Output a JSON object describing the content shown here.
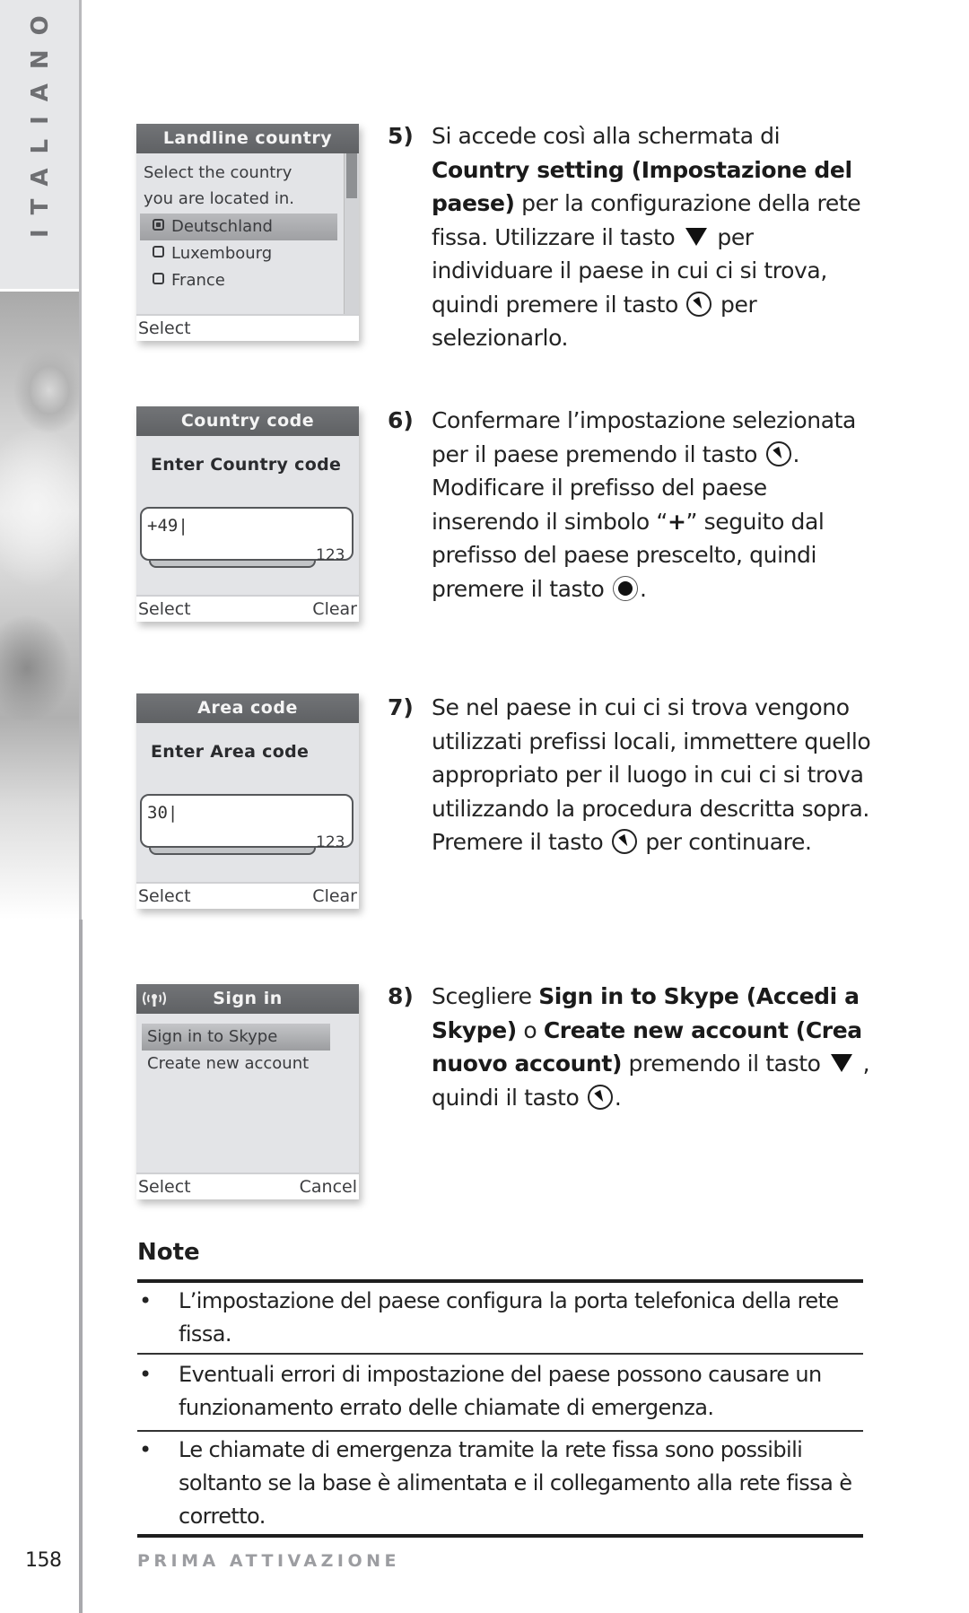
{
  "sidebar": {
    "language_label": "ITALIANO"
  },
  "screens": {
    "landline_country": {
      "title": "Landline country",
      "prompt_line1": "Select the country",
      "prompt_line2": "you are located in.",
      "options": [
        {
          "label": "Deutschland",
          "selected": true
        },
        {
          "label": "Luxembourg",
          "selected": false
        },
        {
          "label": "France",
          "selected": false
        }
      ],
      "softkey_left": "Select"
    },
    "country_code": {
      "title": "Country code",
      "label": "Enter Country code",
      "value": "+49|",
      "input_mode": "123",
      "softkey_left": "Select",
      "softkey_right": "Clear"
    },
    "area_code": {
      "title": "Area code",
      "label": "Enter Area code",
      "value": "30|",
      "input_mode": "123",
      "softkey_left": "Select",
      "softkey_right": "Clear"
    },
    "sign_in": {
      "title": "Sign in",
      "status_icon": "signal-icon",
      "items": [
        {
          "label": "Sign in to Skype",
          "selected": true
        },
        {
          "label": "Create new account",
          "selected": false
        }
      ],
      "softkey_left": "Select",
      "softkey_right": "Cancel"
    }
  },
  "steps": [
    {
      "number": "5)",
      "t1": "Si accede così alla schermata di ",
      "b1": "Country setting (Impostazione del paese)",
      "t2": " per la configurazione della rete fissa. Utilizzare il tasto ",
      "key1": "down-arrow-key",
      "t3": " per individuare il paese in cui ci si trova, quindi premere il tasto ",
      "key2": "ok-key",
      "t4": " per selezionarlo."
    },
    {
      "number": "6)",
      "t1": "Confermare l’impostazione selezionata per il paese premendo il tasto ",
      "key1": "ok-key",
      "t2": ". Modificare il prefisso del paese inserendo il simbolo “",
      "b1": "+",
      "t3": "” seguito dal prefisso del paese prescelto, quindi premere il tasto ",
      "key2": "navigation-key",
      "t4": "."
    },
    {
      "number": "7)",
      "t1": "Se nel paese in cui ci si trova vengono utilizzati prefissi locali, immettere quello appropriato per il luogo in cui ci si trova utilizzando la procedura descritta sopra. Premere il tasto ",
      "key1": "ok-key",
      "t2": " per continuare."
    },
    {
      "number": "8)",
      "t1": "Scegliere ",
      "b1": "Sign in to Skype (Accedi a Skype)",
      "t2": " o ",
      "b2": "Create new account (Crea nuovo account)",
      "t3": " premendo il tasto ",
      "key1": "down-arrow-key",
      "t4": " , quindi il tasto ",
      "key2": "ok-key",
      "t5": "."
    }
  ],
  "note": {
    "title": "Note",
    "items": [
      "L’impostazione del paese configura la porta telefonica della rete fissa.",
      "Eventuali errori di impostazione del paese possono causare un funzionamento errato delle chiamate di emergenza.",
      "Le chiamate di emergenza tramite la rete fissa sono possibili soltanto se la base è alimentata e il collegamento alla rete fissa è corretto."
    ],
    "bullet": "•"
  },
  "footer": {
    "page_number": "158",
    "section": "PRIMA ATTIVAZIONE"
  }
}
